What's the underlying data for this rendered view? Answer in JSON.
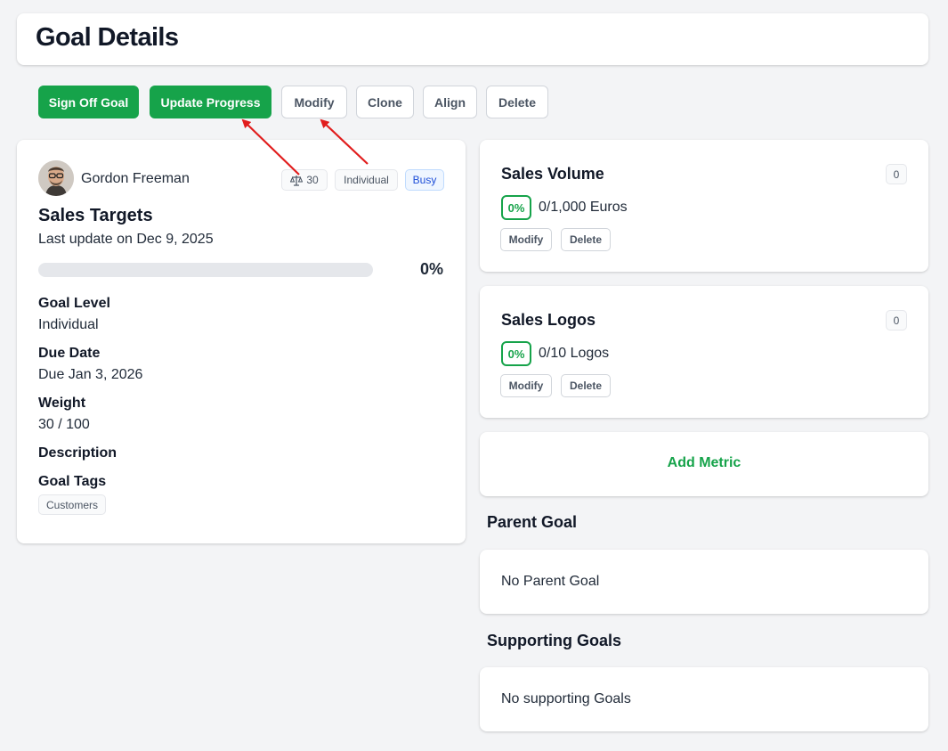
{
  "page": {
    "title": "Goal Details"
  },
  "toolbar": {
    "sign_off": "Sign Off Goal",
    "update_progress": "Update Progress",
    "modify": "Modify",
    "clone": "Clone",
    "align": "Align",
    "delete": "Delete"
  },
  "goal": {
    "owner": "Gordon Freeman",
    "weight_chip": "30",
    "level_chip": "Individual",
    "status_chip": "Busy",
    "title": "Sales Targets",
    "last_update": "Last update on Dec 9, 2025",
    "progress_pct": "0%",
    "progress_value": 0,
    "fields": {
      "level_label": "Goal Level",
      "level_value": "Individual",
      "due_label": "Due Date",
      "due_value": "Due Jan 3, 2026",
      "weight_label": "Weight",
      "weight_value": "30 / 100",
      "description_label": "Description",
      "tags_label": "Goal Tags"
    },
    "tags": [
      "Customers"
    ]
  },
  "metrics": [
    {
      "title": "Sales Volume",
      "count": "0",
      "pct": "0%",
      "value": "0/1,000 Euros",
      "modify": "Modify",
      "delete": "Delete"
    },
    {
      "title": "Sales Logos",
      "count": "0",
      "pct": "0%",
      "value": "0/10 Logos",
      "modify": "Modify",
      "delete": "Delete"
    }
  ],
  "add_metric": "Add Metric",
  "parent_goal": {
    "title": "Parent Goal",
    "text": "No Parent Goal"
  },
  "supporting_goals": {
    "title": "Supporting Goals",
    "text": "No supporting Goals"
  },
  "colors": {
    "accent": "#16a34a",
    "annotation": "#e11d1d",
    "status_blue": "#1d4ed8"
  },
  "icons": {
    "weight": "scale-icon",
    "avatar": "avatar"
  }
}
